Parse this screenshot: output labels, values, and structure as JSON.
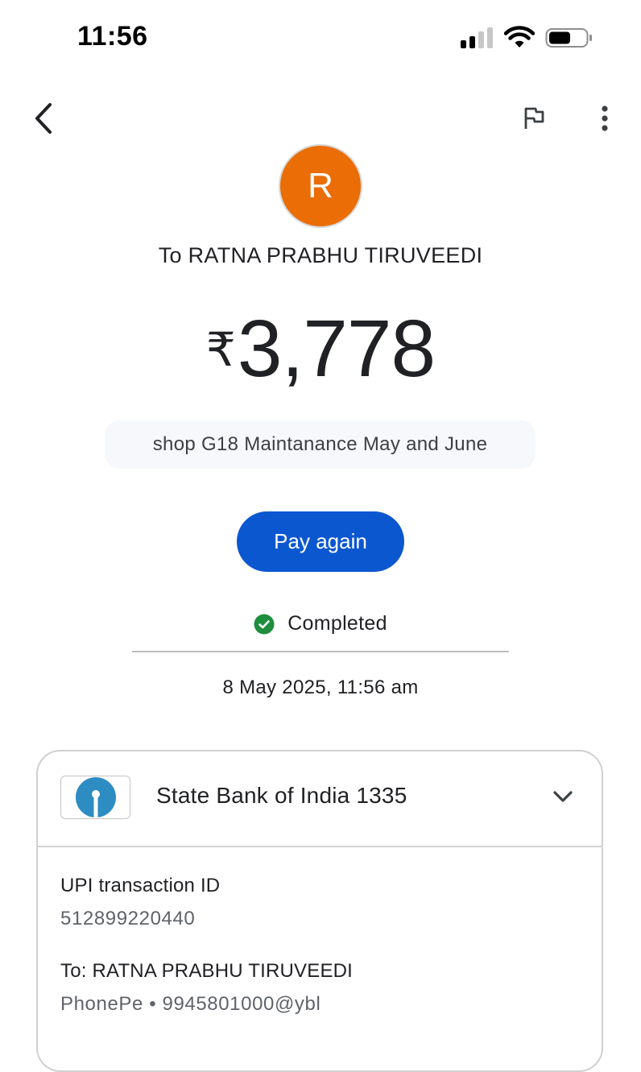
{
  "status_bar": {
    "time": "11:56"
  },
  "header": {
    "back_icon": "back-arrow-icon",
    "flag_icon": "flag-icon",
    "more_icon": "more-vert-icon"
  },
  "payee": {
    "avatar_letter": "R",
    "avatar_color": "#ea6d06",
    "title": "To RATNA PRABHU TIRUVEEDI"
  },
  "amount": {
    "currency_symbol": "₹",
    "value": "3,778"
  },
  "note": "shop G18 Maintanance May and June",
  "actions": {
    "pay_again_label": "Pay again",
    "accent_color": "#0b57d0"
  },
  "status": {
    "label": "Completed",
    "color": "#1e8e3e",
    "datetime": "8 May 2025, 11:56 am"
  },
  "account": {
    "bank_name": "State Bank of India 1335",
    "upi_label": "UPI transaction ID",
    "upi_id": "512899220440",
    "to_label": "To: RATNA PRABHU TIRUVEEDI",
    "to_sub": "PhonePe • 9945801000@ybl"
  }
}
